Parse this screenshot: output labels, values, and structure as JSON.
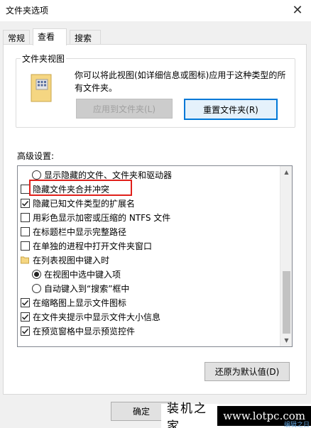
{
  "window": {
    "title": "文件夹选项",
    "close_glyph": "✕"
  },
  "tabs": [
    {
      "label": "常规"
    },
    {
      "label": "查看",
      "active": true
    },
    {
      "label": "搜索"
    }
  ],
  "folder_views": {
    "label": "文件夹视图",
    "description": "你可以将此视图(如详细信息或图标)应用于这种类型的所有文件夹。",
    "apply_button": "应用到文件夹(L)",
    "reset_button": "重置文件夹(R)"
  },
  "advanced": {
    "label": "高级设置:",
    "items": [
      {
        "type": "radio",
        "label": "显示隐藏的文件、文件夹和驱动器",
        "checked": false,
        "indent": 1
      },
      {
        "type": "checkbox",
        "label": "隐藏文件夹合并冲突",
        "checked": false,
        "indent": 0
      },
      {
        "type": "checkbox",
        "label": "隐藏已知文件类型的扩展名",
        "checked": true,
        "indent": 0
      },
      {
        "type": "checkbox",
        "label": "用彩色显示加密或压缩的 NTFS 文件",
        "checked": false,
        "indent": 0
      },
      {
        "type": "checkbox",
        "label": "在标题栏中显示完整路径",
        "checked": false,
        "indent": 0
      },
      {
        "type": "checkbox",
        "label": "在单独的进程中打开文件夹窗口",
        "checked": false,
        "indent": 0
      },
      {
        "type": "folder",
        "label": "在列表视图中键入时",
        "indent": 0
      },
      {
        "type": "radio",
        "label": "在视图中选中键入项",
        "checked": true,
        "indent": 1
      },
      {
        "type": "radio",
        "label": "自动键入到“搜索”框中",
        "checked": false,
        "indent": 1
      },
      {
        "type": "checkbox",
        "label": "在缩略图上显示文件图标",
        "checked": true,
        "indent": 0
      },
      {
        "type": "checkbox",
        "label": "在文件夹提示中显示文件大小信息",
        "checked": true,
        "indent": 0
      },
      {
        "type": "checkbox",
        "label": "在预览窗格中显示预览控件",
        "checked": true,
        "indent": 0
      }
    ],
    "restore_button": "还原为默认值(D)"
  },
  "footer": {
    "ok_button": "确定"
  },
  "watermark": {
    "cn": "装机之家",
    "url": "www.lotpc.com",
    "sub": "编辑之日"
  },
  "colors": {
    "highlight": "#e0201b",
    "accent": "#0078d7"
  }
}
